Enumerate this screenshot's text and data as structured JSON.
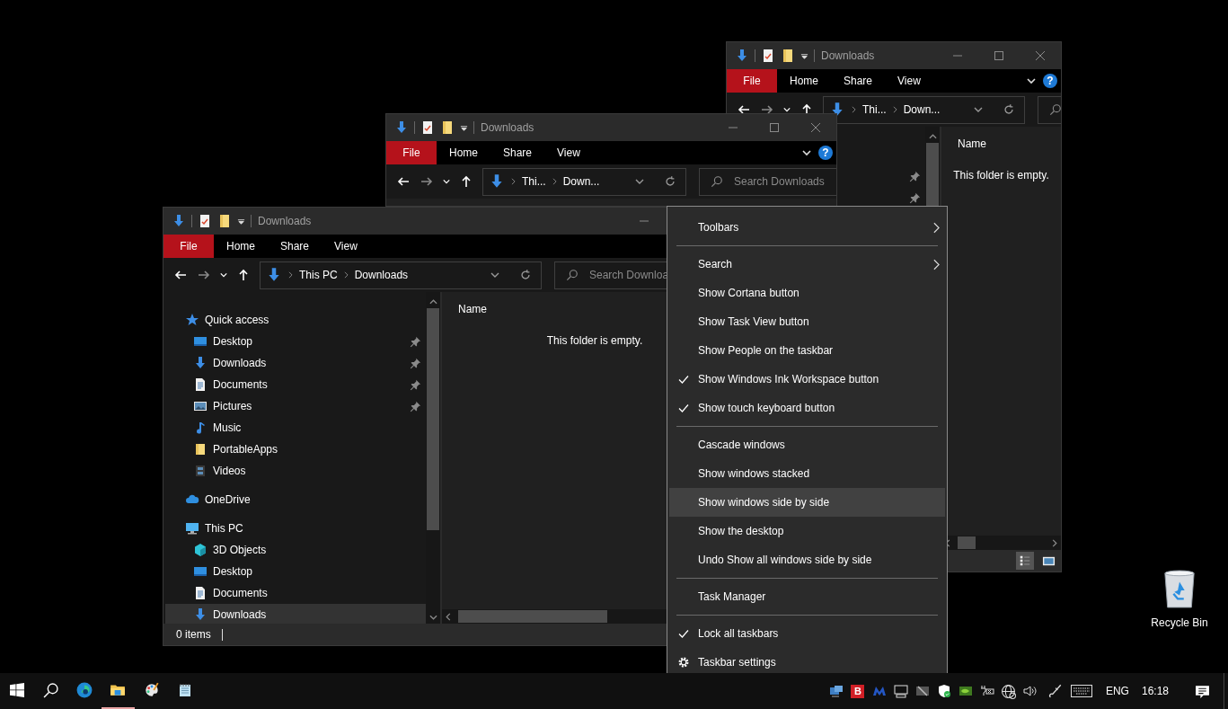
{
  "desktop_icons": [
    {
      "label": "Recycle Bin"
    }
  ],
  "windows": [
    {
      "title": "Downloads",
      "title_buttons": [
        {
          "kind": "minimize"
        },
        {
          "kind": "maximize"
        },
        {
          "kind": "close"
        }
      ],
      "ribbon_tabs": [
        {
          "kind": "file",
          "label": "File"
        },
        {
          "kind": "tab",
          "label": "Home"
        },
        {
          "kind": "tab",
          "label": "Share"
        },
        {
          "kind": "tab",
          "label": "View"
        }
      ],
      "help": "?",
      "breadcrumbs": [
        "Thi...",
        "Down..."
      ],
      "nav": [
        {
          "children": [
            {
              "pinned": true
            },
            {
              "pinned": true
            }
          ]
        }
      ],
      "column_header": "Name",
      "empty_message": "This folder is empty.",
      "view_buttons": [
        {
          "kind": "details",
          "selected": true
        },
        {
          "kind": "large_icons",
          "selected": false
        }
      ]
    },
    {
      "title": "Downloads",
      "title_buttons": [
        {
          "kind": "minimize"
        },
        {
          "kind": "maximize"
        },
        {
          "kind": "close"
        }
      ],
      "ribbon_tabs": [
        {
          "kind": "file",
          "label": "File"
        },
        {
          "kind": "tab",
          "label": "Home"
        },
        {
          "kind": "tab",
          "label": "Share"
        },
        {
          "kind": "tab",
          "label": "View"
        }
      ],
      "help": "?",
      "breadcrumbs": [
        "Thi...",
        "Down..."
      ],
      "search": {
        "placeholder": "Search Downloads"
      }
    },
    {
      "title": "Downloads",
      "title_buttons": [
        {
          "kind": "minimize"
        }
      ],
      "ribbon_tabs": [
        {
          "kind": "file",
          "label": "File"
        },
        {
          "kind": "tab",
          "label": "Home"
        },
        {
          "kind": "tab",
          "label": "Share"
        },
        {
          "kind": "tab",
          "label": "View"
        }
      ],
      "breadcrumbs": [
        "This PC",
        "Downloads"
      ],
      "search": {
        "placeholder": "Search Downloa"
      },
      "nav": [
        {
          "label": "Quick access",
          "kind": "star",
          "selected": false,
          "children": [
            {
              "label": "Desktop",
              "kind": "desktop",
              "pinned": true,
              "selected": false
            },
            {
              "label": "Downloads",
              "kind": "download",
              "pinned": true,
              "selected": false
            },
            {
              "label": "Documents",
              "kind": "documents",
              "pinned": true,
              "selected": false
            },
            {
              "label": "Pictures",
              "kind": "pictures",
              "pinned": true,
              "selected": false
            },
            {
              "label": "Music",
              "kind": "music",
              "pinned": false,
              "selected": false
            },
            {
              "label": "PortableApps",
              "kind": "folder",
              "pinned": false,
              "selected": false
            },
            {
              "label": "Videos",
              "kind": "videos",
              "pinned": false,
              "selected": false
            }
          ]
        },
        {
          "label": "OneDrive",
          "kind": "cloud",
          "selected": false
        },
        {
          "label": "This PC",
          "kind": "pc",
          "selected": false,
          "children": [
            {
              "label": "3D Objects",
              "kind": "cube",
              "pinned": false,
              "selected": false
            },
            {
              "label": "Desktop",
              "kind": "desktop",
              "pinned": false,
              "selected": false
            },
            {
              "label": "Documents",
              "kind": "documents",
              "pinned": false,
              "selected": false
            },
            {
              "label": "Downloads",
              "kind": "download",
              "pinned": false,
              "selected": true
            }
          ]
        }
      ],
      "column_header": "Name",
      "empty_message": "This folder is empty.",
      "status_text": "0 items"
    }
  ],
  "context_menu": {
    "items": [
      {
        "kind": "item",
        "label": "Toolbars",
        "submenu": true,
        "checked": false,
        "selected": false
      },
      {
        "kind": "separator"
      },
      {
        "kind": "item",
        "label": "Search",
        "submenu": true,
        "checked": false,
        "selected": false
      },
      {
        "kind": "item",
        "label": "Show Cortana button",
        "submenu": false,
        "checked": false,
        "selected": false
      },
      {
        "kind": "item",
        "label": "Show Task View button",
        "submenu": false,
        "checked": false,
        "selected": false
      },
      {
        "kind": "item",
        "label": "Show People on the taskbar",
        "submenu": false,
        "checked": false,
        "selected": false
      },
      {
        "kind": "item",
        "label": "Show Windows Ink Workspace button",
        "submenu": false,
        "checked": true,
        "selected": false
      },
      {
        "kind": "item",
        "label": "Show touch keyboard button",
        "submenu": false,
        "checked": true,
        "selected": false
      },
      {
        "kind": "separator"
      },
      {
        "kind": "item",
        "label": "Cascade windows",
        "submenu": false,
        "checked": false,
        "selected": false
      },
      {
        "kind": "item",
        "label": "Show windows stacked",
        "submenu": false,
        "checked": false,
        "selected": false
      },
      {
        "kind": "item",
        "label": "Show windows side by side",
        "submenu": false,
        "checked": false,
        "selected": true
      },
      {
        "kind": "item",
        "label": "Show the desktop",
        "submenu": false,
        "checked": false,
        "selected": false
      },
      {
        "kind": "item",
        "label": "Undo Show all windows side by side",
        "submenu": false,
        "checked": false,
        "selected": false
      },
      {
        "kind": "separator"
      },
      {
        "kind": "item",
        "label": "Task Manager",
        "submenu": false,
        "checked": false,
        "selected": false
      },
      {
        "kind": "separator"
      },
      {
        "kind": "item",
        "label": "Lock all taskbars",
        "submenu": false,
        "checked": true,
        "selected": false
      },
      {
        "kind": "settings",
        "label": "Taskbar settings",
        "submenu": false,
        "checked": false,
        "selected": false
      }
    ]
  },
  "taskbar": {
    "apps": [
      {
        "kind": "start",
        "active": false
      },
      {
        "kind": "search",
        "active": false
      },
      {
        "kind": "edge",
        "active": false
      },
      {
        "kind": "explorer",
        "active": true
      },
      {
        "kind": "paint",
        "active": false
      },
      {
        "kind": "notepad",
        "active": false
      }
    ],
    "tray": [
      {
        "kind": "device"
      },
      {
        "kind": "letter",
        "text": "B"
      },
      {
        "kind": "m_logo"
      },
      {
        "kind": "monitor"
      },
      {
        "kind": "stylus"
      },
      {
        "kind": "shield"
      },
      {
        "kind": "gpu"
      },
      {
        "kind": "battery"
      },
      {
        "kind": "globe"
      },
      {
        "kind": "speaker"
      },
      {
        "kind": "pen"
      },
      {
        "kind": "keyboard"
      }
    ],
    "language": "ENG",
    "time": "16:18"
  }
}
